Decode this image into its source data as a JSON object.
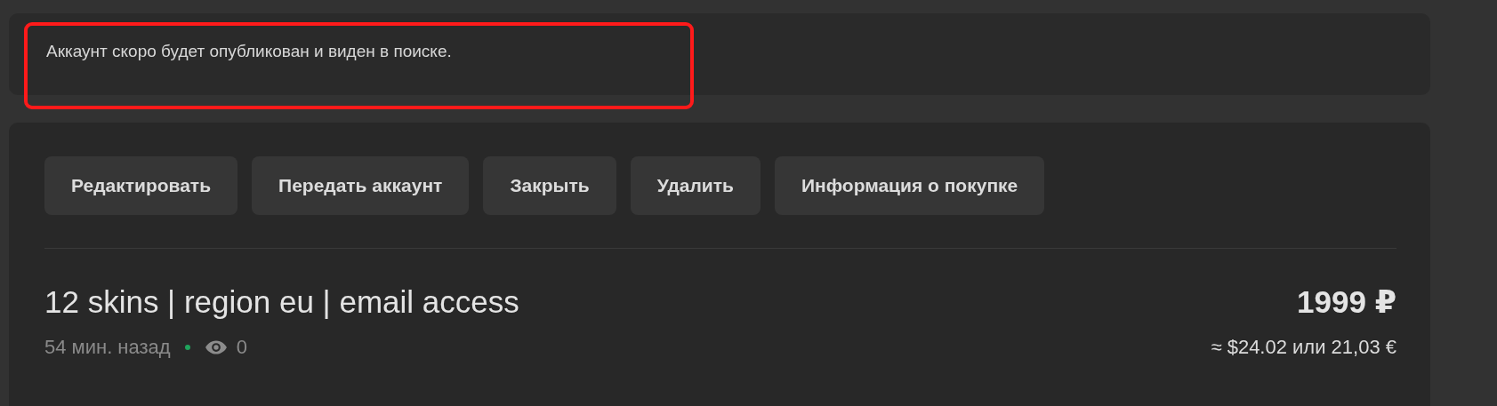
{
  "notice": {
    "text": "Аккаунт скоро будет опубликован и виден в поиске.",
    "highlighted": true
  },
  "actions": [
    {
      "label": "Редактировать"
    },
    {
      "label": "Передать аккаунт"
    },
    {
      "label": "Закрыть"
    },
    {
      "label": "Удалить"
    },
    {
      "label": "Информация о покупке"
    }
  ],
  "listing": {
    "title": "12 skins | region eu | email access",
    "price": "1999 ₽",
    "posted": "54 мин. назад",
    "online": true,
    "views": "0",
    "converted_price": "≈ $24.02 или 21,03 €"
  }
}
